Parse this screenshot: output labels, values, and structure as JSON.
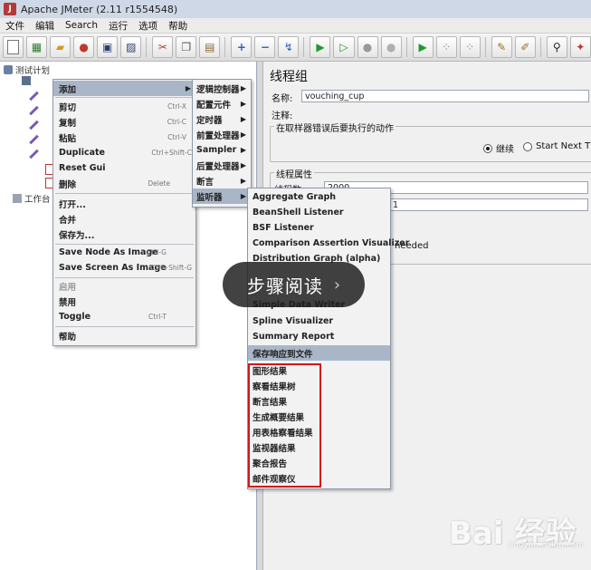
{
  "window": {
    "title": "Apache JMeter (2.11 r1554548)"
  },
  "menubar": [
    "文件",
    "编辑",
    "Search",
    "运行",
    "选项",
    "帮助"
  ],
  "toolbar_icons": [
    "new-icon",
    "templates-icon",
    "open-icon",
    "close-icon",
    "save-icon",
    "save-as-icon",
    "cut-icon",
    "copy-icon",
    "paste-icon",
    "expand-icon",
    "collapse-icon",
    "toggle-icon",
    "start-icon",
    "start-no-pause-icon",
    "stop-icon",
    "shutdown-icon",
    "remote-start-icon",
    "remote-stop-icon",
    "remote-exit-icon",
    "clear-icon",
    "clear-all-icon",
    "search-icon",
    "reset-search-icon"
  ],
  "tree": {
    "root": "测试计划",
    "workbench": "工作台"
  },
  "thread_group": {
    "title": "线程组",
    "name_label": "名称:",
    "name_value": "vouching_cup",
    "comment_label": "注释:",
    "error_action_title": "在取样器错误后要执行的动作",
    "continue_label": "继续",
    "start_next_label": "Start Next Thr",
    "properties_title": "线程属性",
    "threads_label": "线程数:",
    "threads_value": "2000",
    "ramp_value": "1",
    "needed_text": "l needed"
  },
  "context_menu": {
    "items": [
      {
        "label": "添加",
        "accel": "",
        "submenu": true,
        "highlight": true
      },
      {
        "label": "剪切",
        "accel": "Ctrl-X"
      },
      {
        "label": "复制",
        "accel": "Ctrl-C"
      },
      {
        "label": "粘贴",
        "accel": "Ctrl-V"
      },
      {
        "label": "Duplicate",
        "accel": "Ctrl+Shift-C"
      },
      {
        "label": "Reset Gui",
        "accel": ""
      },
      {
        "label": "删除",
        "accel": "Delete"
      },
      {
        "label": "打开...",
        "accel": ""
      },
      {
        "label": "合并",
        "accel": ""
      },
      {
        "label": "保存为...",
        "accel": ""
      },
      {
        "label": "Save Node As Image",
        "accel": "Ctrl-G"
      },
      {
        "label": "Save Screen As Image",
        "accel": "Ctrl+Shift-G"
      },
      {
        "label": "启用",
        "accel": "",
        "disabled": true
      },
      {
        "label": "禁用",
        "accel": ""
      },
      {
        "label": "Toggle",
        "accel": "Ctrl-T"
      },
      {
        "label": "帮助",
        "accel": ""
      }
    ]
  },
  "add_submenu": {
    "items": [
      "逻辑控制器",
      "配置元件",
      "定时器",
      "前置处理器",
      "Sampler",
      "后置处理器",
      "断言",
      "监听器"
    ]
  },
  "listener_submenu": {
    "items": [
      "Aggregate Graph",
      "BeanShell Listener",
      "BSF Listener",
      "Comparison Assertion Visualizer",
      "Distribution Graph (alpha)",
      "Simple Data Writer",
      "Spline Visualizer",
      "Summary Report",
      "保存响应到文件",
      "图形结果",
      "察看结果树",
      "断言结果",
      "生成概要结果",
      "用表格察看结果",
      "监视器结果",
      "聚合报告",
      "邮件观察仪"
    ]
  },
  "overlay": {
    "text": "步骤阅读",
    "chevron": "›"
  },
  "watermark": {
    "text": "Bai 经验",
    "sub": "jingyan.baidu.com"
  }
}
